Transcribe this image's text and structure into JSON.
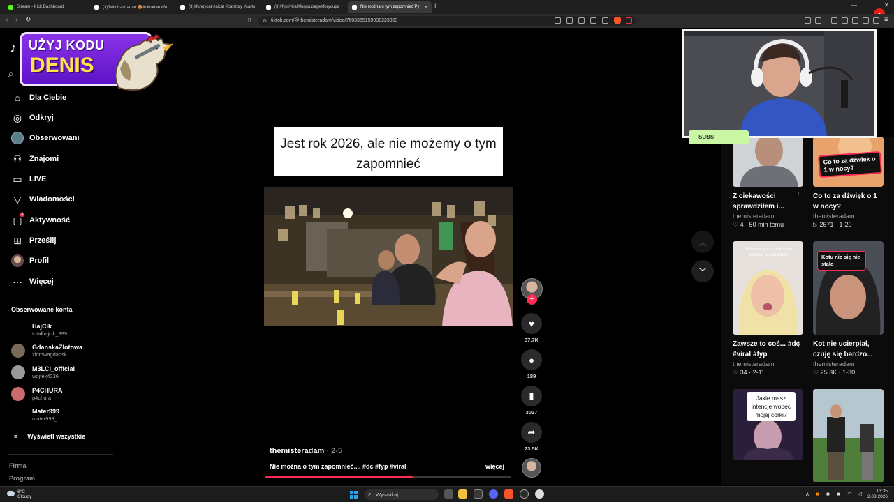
{
  "browser": {
    "tabs": [
      {
        "title": "Stream - Kick Dashboard",
        "fav": "#53fc18"
      },
      {
        "title": "(3)Twitch-ultradan 🍪#ultradan #fo",
        "fav": "#ffffff"
      },
      {
        "title": "(3)#funnycat #aicat #catstory #carto",
        "fav": "#ffffff"
      },
      {
        "title": "(3)#fyp#viral#foryoupage#foryoupa",
        "fav": "#ffffff"
      },
      {
        "title": "Nie można o tym zapomnieć Py",
        "fav": "#ffffff"
      }
    ],
    "url": "tiktok.com/@themisteradam/video/7603355159938223363"
  },
  "promo": {
    "line1": "UŻYJ KODU",
    "line2": "DENIS"
  },
  "sidebar": {
    "nav": [
      {
        "label": "Dla Ciebie",
        "icon": "home-icon"
      },
      {
        "label": "Odkryj",
        "icon": "compass-icon"
      },
      {
        "label": "Obserwowani",
        "icon": "following-avatar-icon"
      },
      {
        "label": "Znajomi",
        "icon": "friends-icon"
      },
      {
        "label": "LIVE",
        "icon": "live-icon"
      },
      {
        "label": "Wiadomości",
        "icon": "messages-icon"
      },
      {
        "label": "Aktywność",
        "icon": "activity-icon",
        "badge": "3"
      },
      {
        "label": "Prześlij",
        "icon": "upload-icon"
      },
      {
        "label": "Profil",
        "icon": "profile-avatar-icon"
      },
      {
        "label": "Więcej",
        "icon": "more-icon"
      }
    ],
    "following_title": "Obserwowane konta",
    "accounts": [
      {
        "name": "HajCik",
        "handle": "totalhajcik_999",
        "color": "#000000"
      },
      {
        "name": "GdanskaZlotowa",
        "handle": "zlotowagdansk",
        "color": "#7a6a5a"
      },
      {
        "name": "M3LCI_official",
        "handle": "wojtek4236",
        "color": "#9a9a9a"
      },
      {
        "name": "P4CHURA",
        "handle": "p4chura",
        "color": "#c96b6b"
      },
      {
        "name": "Mater999",
        "handle": "mater999_",
        "color": "#000000"
      }
    ],
    "show_all": "Wyświetl wszystkie",
    "footer": [
      "Firma",
      "Program"
    ]
  },
  "video": {
    "caption": "Jest rok 2026, ale nie możemy o tym zapomnieć",
    "author": "themisteradam",
    "date": "· 2-5",
    "description": "Nie można o tym zapomnieć.... #dc #fyp #viral",
    "more": "więcej",
    "progress": 0.6,
    "actions": {
      "likes": "37.7K",
      "comments": "189",
      "saves": "3027",
      "shares": "23.5K"
    }
  },
  "recommended": [
    {
      "title": "Z ciekawości sprawdziłem i...",
      "user": "themisteradam",
      "meta": "4 · 50 min temu",
      "overlay": ""
    },
    {
      "title": "Co to za dźwięk o 1 w nocy?",
      "user": "themisteradam",
      "meta": "2671 · 1-20",
      "overlay": "Co to za dźwięk o 1 w nocy?"
    },
    {
      "title": "Zawsze to coś... #dc #viral #fyp",
      "user": "themisteradam",
      "meta": "34 · 2-11",
      "overlay": "Show me your completely useless secret talent"
    },
    {
      "title": "Kot nie ucierpiał, czuję się bardzo...",
      "user": "themisteradam",
      "meta": "25.3K · 1-30",
      "overlay": "Kotu nic się nie stało"
    },
    {
      "title": "",
      "user": "",
      "meta": "",
      "overlay": "Jakie masz intencje wobec mojej córki?"
    },
    {
      "title": "",
      "user": "",
      "meta": "",
      "overlay": ""
    }
  ],
  "overlay": {
    "subs_label": "SUBS"
  },
  "taskbar": {
    "temp": "6°C",
    "weather": "Cloudy",
    "search": "Wyszukaj",
    "time": "13:35",
    "date": "2.03.2026"
  },
  "colors": {
    "accent": "#fe2c55",
    "promo": "#7b2ce0",
    "subs": "#c9f7a3"
  }
}
